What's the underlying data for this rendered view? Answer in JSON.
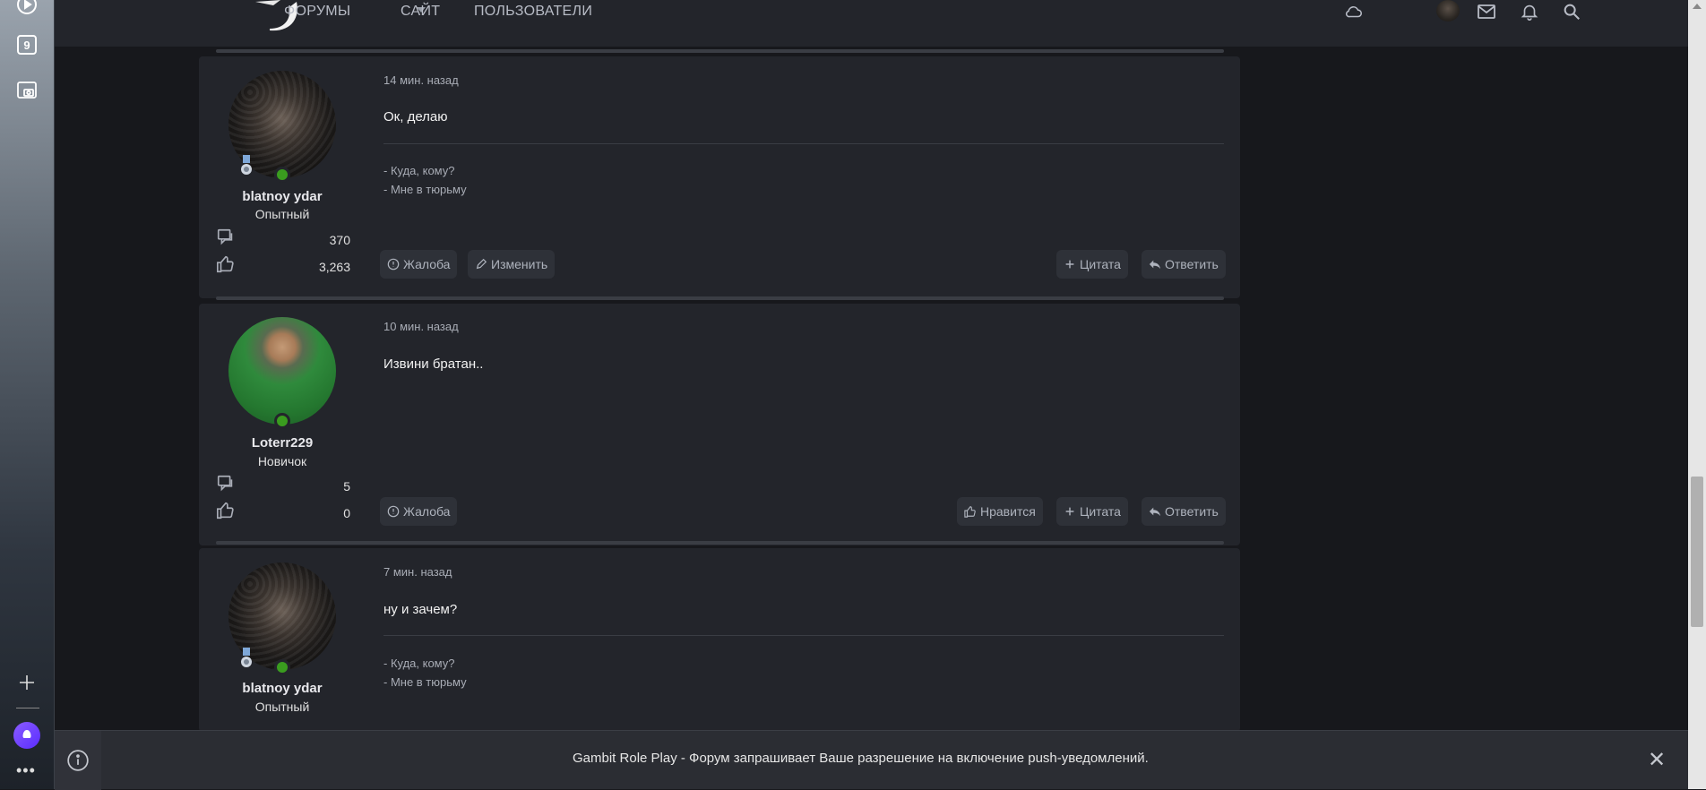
{
  "nav": {
    "forums": "ФОРУМЫ",
    "site": "САЙТ",
    "users": "ПОЛЬЗОВАТЕЛИ"
  },
  "sidebar": {
    "badge": "9"
  },
  "posts": [
    {
      "time": "14 мин. назад",
      "message": "Ок, делаю",
      "signature": [
        "- Куда, кому?",
        "- Мне в тюрьму"
      ],
      "username": "blatnoy ydar",
      "user_title": "Опытный",
      "messages_count": "370",
      "reactions_count": "3,263",
      "actions_left": [
        "Жалоба",
        "Изменить"
      ],
      "actions_right": [
        "Цитата",
        "Ответить"
      ]
    },
    {
      "time": "10 мин. назад",
      "message": "Извини братан..",
      "username": "Loterr229",
      "user_title": "Новичок",
      "messages_count": "5",
      "reactions_count": "0",
      "actions_left": [
        "Жалоба"
      ],
      "actions_right": [
        "Нравится",
        "Цитата",
        "Ответить"
      ]
    },
    {
      "time": "7 мин. назад",
      "message": "ну и зачем?",
      "signature": [
        "- Куда, кому?",
        "- Мне в тюрьму"
      ],
      "username": "blatnoy ydar",
      "user_title": "Опытный"
    }
  ],
  "notification": {
    "text": "Gambit Role Play - Форум запрашивает Ваше разрешение на включение push-уведомлений."
  },
  "colors": {
    "page_bg": "#17181c",
    "post_bg": "#23252b",
    "button_bg": "#2e3138",
    "online": "#3a9c1f"
  }
}
